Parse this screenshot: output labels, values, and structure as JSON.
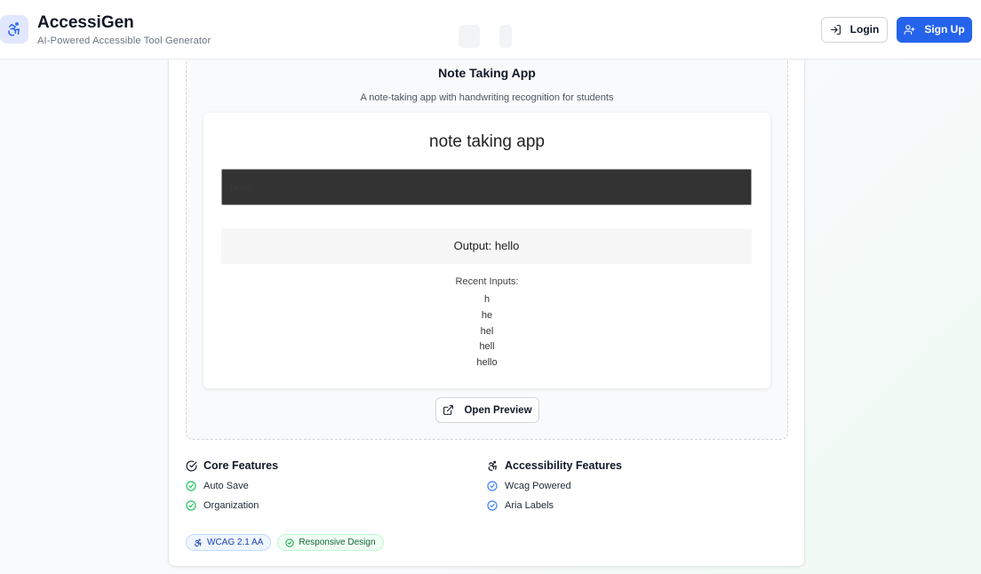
{
  "header": {
    "app_name": "AccessiGen",
    "tagline": "AI-Powered Accessible Tool Generator",
    "login_label": "Login",
    "signup_label": "Sign Up"
  },
  "preview": {
    "title": "Note Taking App",
    "description": "A note-taking app with handwriting recognition for students",
    "app_heading": "note taking app",
    "input_value": "hello",
    "output_text": "Output: hello",
    "recent_label": "Recent Inputs:",
    "recent_items": [
      "h",
      "he",
      "hel",
      "hell",
      "hello"
    ],
    "open_preview_label": "Open Preview"
  },
  "features": {
    "core_title": "Core Features",
    "core_items": [
      "Auto Save",
      "Organization"
    ],
    "accessibility_title": "Accessibility Features",
    "accessibility_items": [
      "Wcag Powered",
      "Aria Labels"
    ]
  },
  "badges": {
    "wcag": "WCAG 2.1 AA",
    "responsive": "Responsive Design"
  },
  "colors": {
    "brand_blue": "#2563eb",
    "success_green": "#22c55e",
    "info_blue": "#3b82f6"
  },
  "icons": {
    "brand": "accessibility-icon",
    "login": "login-icon",
    "signup": "user-plus-icon",
    "open_preview": "external-link-icon",
    "check": "check-circle-icon"
  }
}
